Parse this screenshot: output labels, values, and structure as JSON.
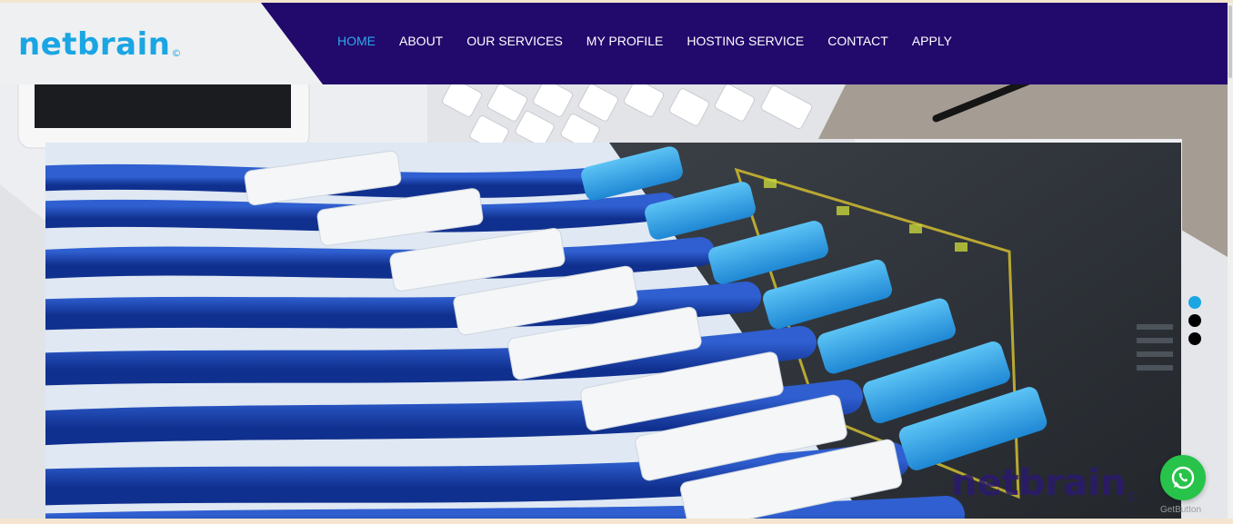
{
  "brand": {
    "logo_text": "netbrain",
    "logo_mark": "©",
    "watermark_text": "netbrain",
    "watermark_mark": "©"
  },
  "nav": {
    "items": [
      {
        "label": "HOME",
        "active": true
      },
      {
        "label": "ABOUT",
        "active": false
      },
      {
        "label": "OUR SERVICES",
        "active": false
      },
      {
        "label": "MY PROFILE",
        "active": false
      },
      {
        "label": "HOSTING SERVICE",
        "active": false
      },
      {
        "label": "CONTACT",
        "active": false
      },
      {
        "label": "APPLY",
        "active": false
      }
    ]
  },
  "slider": {
    "image": "network-cables-switch",
    "slide_count": 3,
    "active_slide": 1
  },
  "whatsapp": {
    "icon": "whatsapp-icon",
    "caption": "GetButton"
  },
  "colors": {
    "nav_bg": "#22096c",
    "accent": "#1aa5e3",
    "active_link": "#2ea8ec",
    "whatsapp": "#28c34a"
  }
}
